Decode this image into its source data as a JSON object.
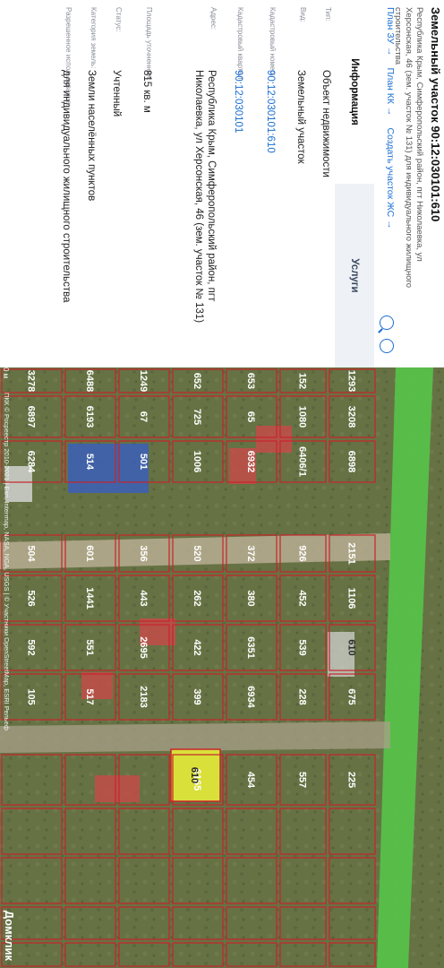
{
  "header": {
    "title": "Земельный участок 90:12:030101:610",
    "address": "Республика Крым, Симферопольский район, пгт Николаевка, ул Херсонская, 46 (зем. участок № 131) для индивидуального жилищного строительства"
  },
  "links": [
    "План ЗУ →",
    "План КК →",
    "Создать участок ЖС →"
  ],
  "tools": {
    "search_icon": "search-icon",
    "target_icon": "target-icon"
  },
  "tabs": [
    {
      "label": "Информация",
      "active": true
    },
    {
      "label": "Услуги",
      "active": false
    }
  ],
  "info": [
    {
      "label": "Тип:",
      "value": "Объект недвижимости",
      "link": false
    },
    {
      "label": "Вид:",
      "value": "Земельный участок",
      "link": false
    },
    {
      "label": "Кадастровый номер:",
      "value": "90:12:030101:610",
      "link": true
    },
    {
      "label": "Кадастровый квартал:",
      "value": "90:12:030101",
      "link": true
    },
    {
      "label": "Адрес:",
      "value": "Республика Крым, Симферопольский район, пгт Николаевка, ул Херсонская, 46 (зем. участок № 131)",
      "link": false
    },
    {
      "label": "Площадь уточненная:",
      "value": "815 кв. м",
      "link": false
    },
    {
      "label": "Статус:",
      "value": "Учтенный",
      "link": false
    },
    {
      "label": "Категория земель:",
      "value": "Земли населённых пунктов",
      "link": false
    },
    {
      "label": "Разрешенное использование:",
      "value": "для индивидуального жилищного строительства",
      "link": false
    }
  ],
  "map": {
    "selected_plot": "610",
    "plots": [
      "1293",
      "152",
      "653",
      "652",
      "1249",
      "6488",
      "3278",
      "3208",
      "1080",
      "65",
      "725",
      "67",
      "6193",
      "6897",
      "6898",
      "6406/1",
      "6932",
      "1006",
      "501",
      "514",
      "6284",
      "2151",
      "926",
      "372",
      "520",
      "356",
      "601",
      "504",
      "1106",
      "452",
      "380",
      "262",
      "443",
      "1441",
      "526",
      "610",
      "539",
      "6351",
      "422",
      "2695",
      "551",
      "592",
      "675",
      "228",
      "6934",
      "399",
      "2183",
      "517",
      "105",
      "225",
      "557",
      "454",
      "6165"
    ],
    "attribution": "ПКК © Росреестр 2010-2021 | Esri, Intermap, NASA, NGA, USGS | © Участники OpenStreetMap, ESRI Рельеф",
    "logo": "Домклик",
    "scale": "0 м",
    "colors": {
      "boundary": "#c8242b",
      "green_zone": "#57c24a",
      "selected": "#d9e03a"
    }
  }
}
